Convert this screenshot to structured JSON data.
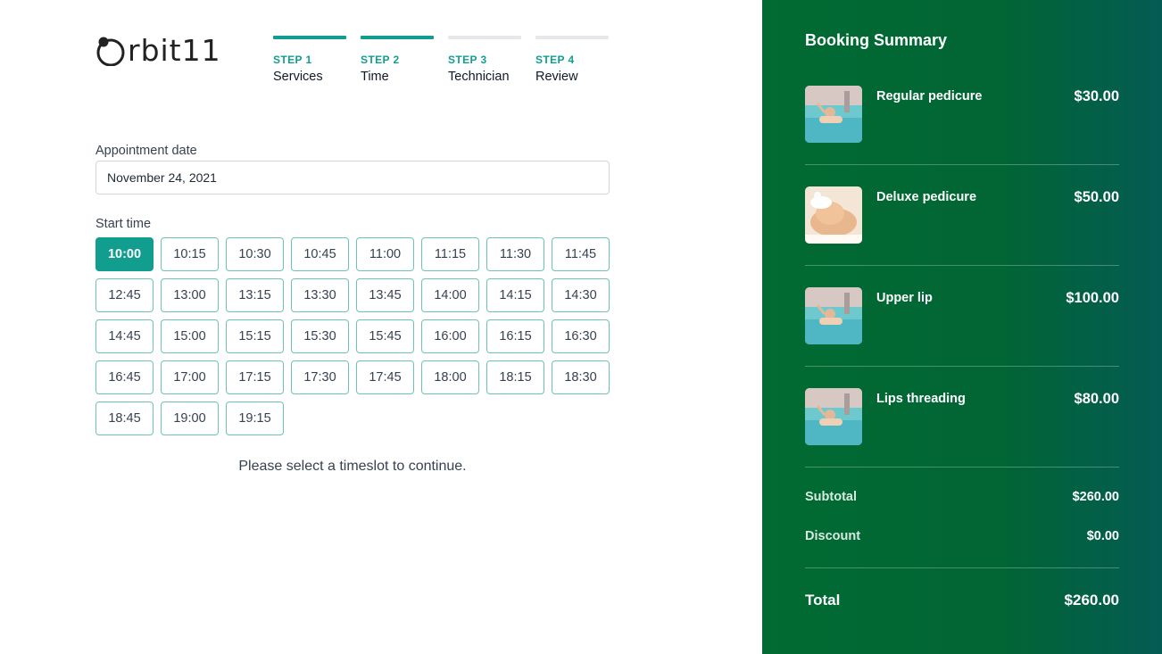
{
  "brand": {
    "name": "rbit11",
    "accent": "#119e8f",
    "sidebar_green": "#016b33"
  },
  "steps": [
    {
      "num": "STEP 1",
      "label": "Services",
      "done": true
    },
    {
      "num": "STEP 2",
      "label": "Time",
      "done": true
    },
    {
      "num": "STEP 3",
      "label": "Technician",
      "done": false
    },
    {
      "num": "STEP 4",
      "label": "Review",
      "done": false
    }
  ],
  "date_field": {
    "label": "Appointment date",
    "value": "November 24, 2021"
  },
  "time_field": {
    "label": "Start time",
    "selected": "10:00",
    "slots": [
      "10:00",
      "10:15",
      "10:30",
      "10:45",
      "11:00",
      "11:15",
      "11:30",
      "11:45",
      "12:45",
      "13:00",
      "13:15",
      "13:30",
      "13:45",
      "14:00",
      "14:15",
      "14:30",
      "14:45",
      "15:00",
      "15:15",
      "15:30",
      "15:45",
      "16:00",
      "16:15",
      "16:30",
      "16:45",
      "17:00",
      "17:15",
      "17:30",
      "17:45",
      "18:00",
      "18:15",
      "18:30",
      "18:45",
      "19:00",
      "19:15"
    ]
  },
  "hint": "Please select a timeslot to continue.",
  "summary": {
    "title": "Booking Summary",
    "items": [
      {
        "name": "Regular pedicure",
        "price": "$30.00",
        "image": "pool-spa-photo"
      },
      {
        "name": "Deluxe pedicure",
        "price": "$50.00",
        "image": "face-spa-photo"
      },
      {
        "name": "Upper lip",
        "price": "$100.00",
        "image": "pool-spa-photo"
      },
      {
        "name": "Lips threading",
        "price": "$80.00",
        "image": "pool-spa-photo"
      }
    ],
    "subtotal_label": "Subtotal",
    "subtotal": "$260.00",
    "discount_label": "Discount",
    "discount": "$0.00",
    "total_label": "Total",
    "total": "$260.00"
  }
}
